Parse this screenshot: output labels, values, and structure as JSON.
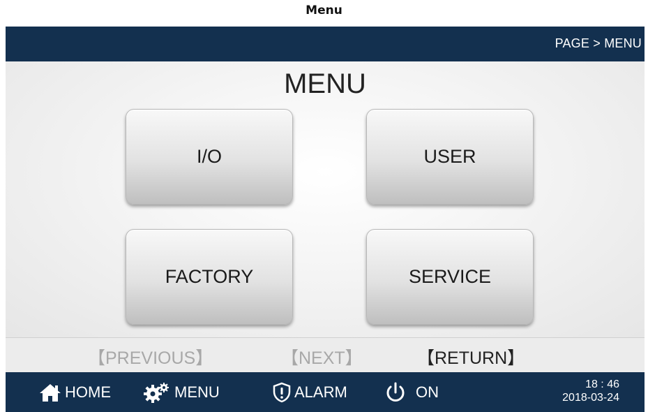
{
  "caption": "Menu",
  "header": {
    "breadcrumb": "PAGE > MENU"
  },
  "main": {
    "title": "MENU",
    "buttons": {
      "io": "I/O",
      "user": "USER",
      "factory": "FACTORY",
      "service": "SERVICE"
    }
  },
  "nav": {
    "previous": "【PREVIOUS】",
    "next": "【NEXT】",
    "return": "【RETURN】"
  },
  "footer": {
    "home": "HOME",
    "menu": "MENU",
    "alarm": "ALARM",
    "power": "ON",
    "time": "18 : 46",
    "date": "2018-03-24"
  },
  "icons": {
    "home": "home-icon",
    "menu": "gears-icon",
    "alarm": "shield-alert-icon",
    "power": "power-icon"
  },
  "colors": {
    "bar": "#13304f",
    "disabled": "#a8a8a8"
  }
}
